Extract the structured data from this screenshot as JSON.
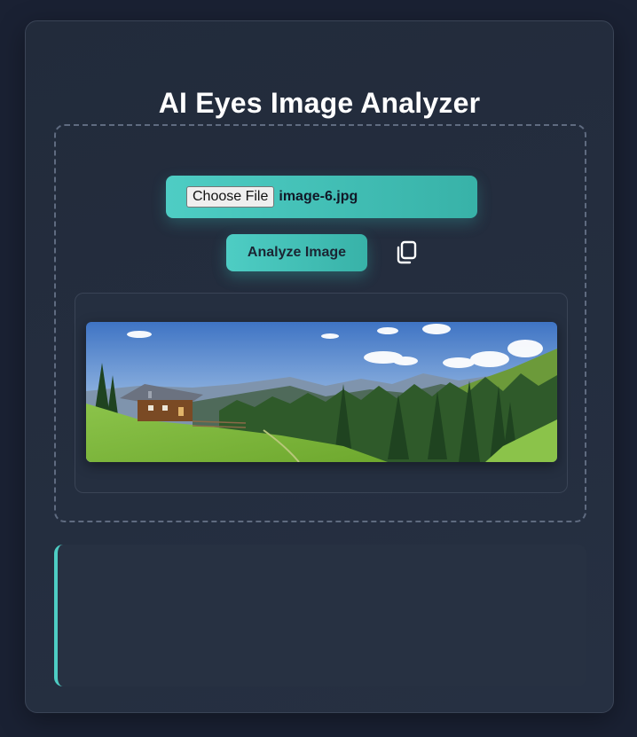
{
  "header": {
    "title": "AI Eyes Image Analyzer"
  },
  "upload": {
    "choose_file_label": "Choose File",
    "file_name": "image-6.jpg"
  },
  "actions": {
    "analyze_label": "Analyze Image",
    "copy_icon": "copy-icon"
  },
  "preview": {
    "image_subject": "mountain-cabin-landscape"
  },
  "result": {
    "text": ""
  },
  "colors": {
    "accent": "#4ecdc4",
    "background": "#1a2133",
    "card": "#232c3c",
    "title": "#ffffff"
  }
}
